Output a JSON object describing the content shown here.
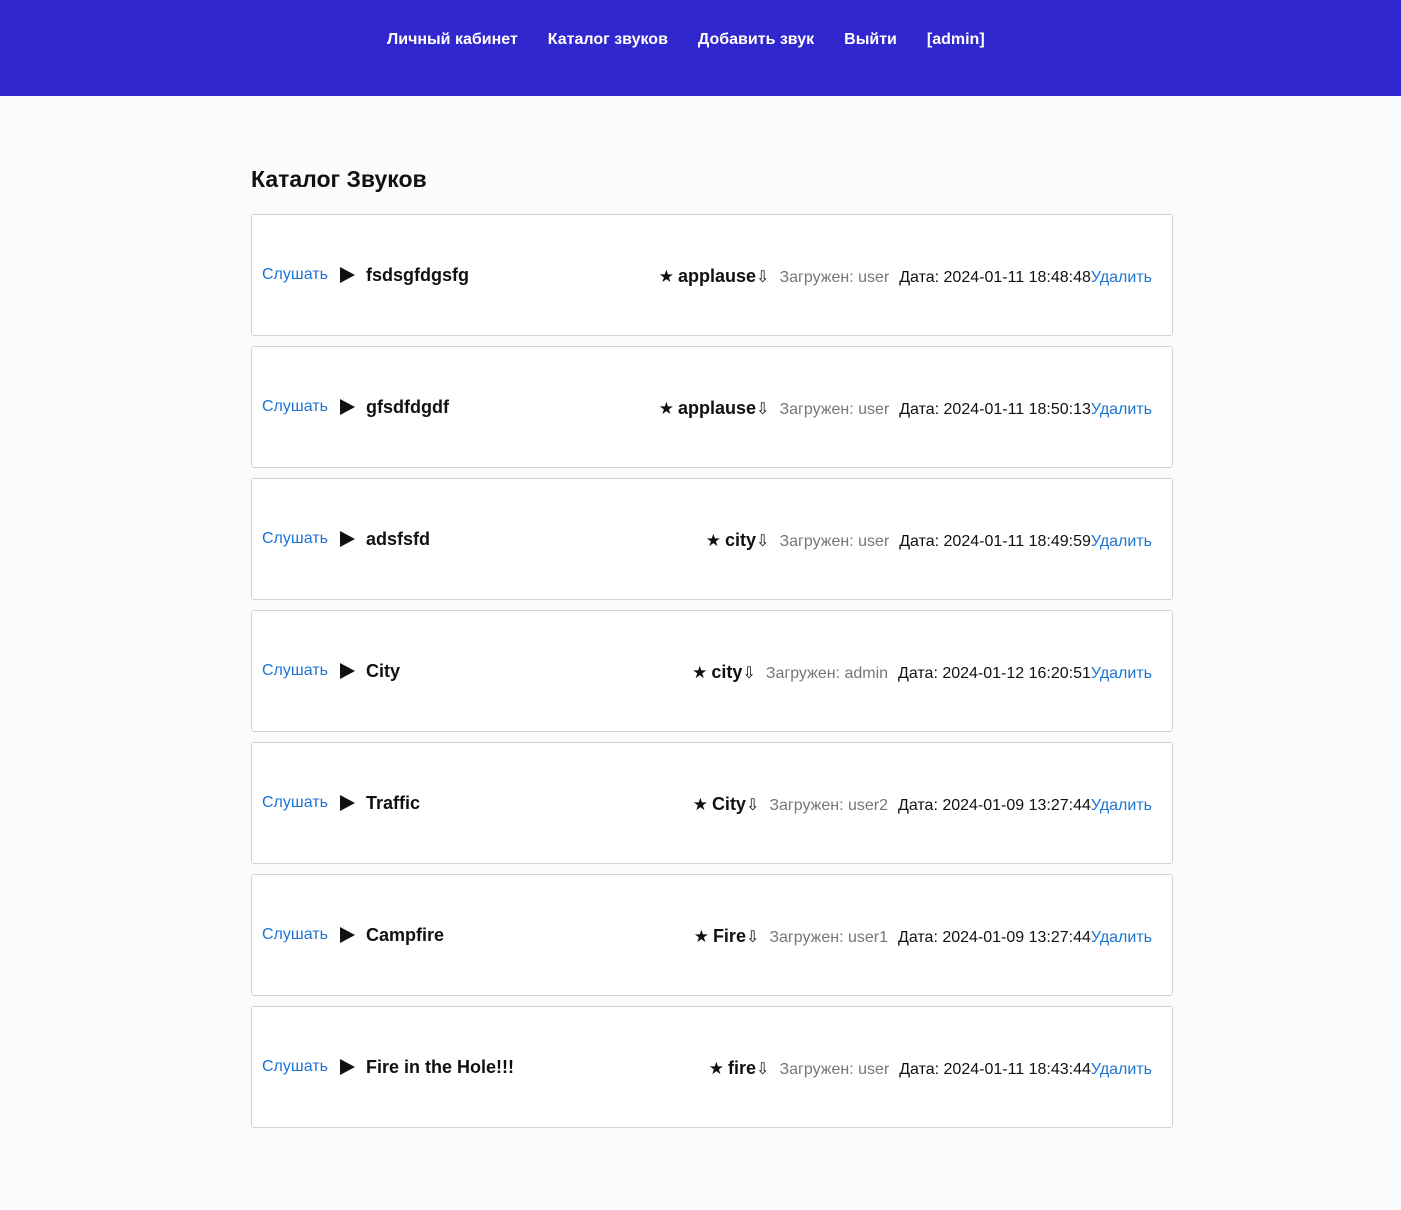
{
  "nav": {
    "items": [
      {
        "label": "Личный кабинет"
      },
      {
        "label": "Каталог звуков"
      },
      {
        "label": "Добавить звук"
      },
      {
        "label": "Выйти"
      },
      {
        "label": "[admin]"
      }
    ]
  },
  "page": {
    "title": "Каталог Звуков"
  },
  "labels": {
    "listen": "Слушать",
    "delete": "Удалить"
  },
  "colors": {
    "header_bg": "#3127cf",
    "link": "#1d74d4",
    "muted": "#777777"
  },
  "icons": {
    "play": "play-icon",
    "star": "star-icon",
    "download": "download-icon"
  },
  "sounds": [
    {
      "title": "fsdsgfdgsfg",
      "category": "applause",
      "uploaded": "Загружен: user",
      "date": "Дата: 2024-01-11 18:48:48"
    },
    {
      "title": "gfsdfdgdf",
      "category": "applause",
      "uploaded": "Загружен: user",
      "date": "Дата: 2024-01-11 18:50:13"
    },
    {
      "title": "adsfsfd",
      "category": "city",
      "uploaded": "Загружен: user",
      "date": "Дата: 2024-01-11 18:49:59"
    },
    {
      "title": "City",
      "category": "city",
      "uploaded": "Загружен: admin",
      "date": "Дата: 2024-01-12 16:20:51"
    },
    {
      "title": "Traffic",
      "category": "City",
      "uploaded": "Загружен: user2",
      "date": "Дата: 2024-01-09 13:27:44"
    },
    {
      "title": "Campfire",
      "category": "Fire",
      "uploaded": "Загружен: user1",
      "date": "Дата: 2024-01-09 13:27:44"
    },
    {
      "title": "Fire in the Hole!!!",
      "category": "fire",
      "uploaded": "Загружен: user",
      "date": "Дата: 2024-01-11 18:43:44"
    }
  ]
}
